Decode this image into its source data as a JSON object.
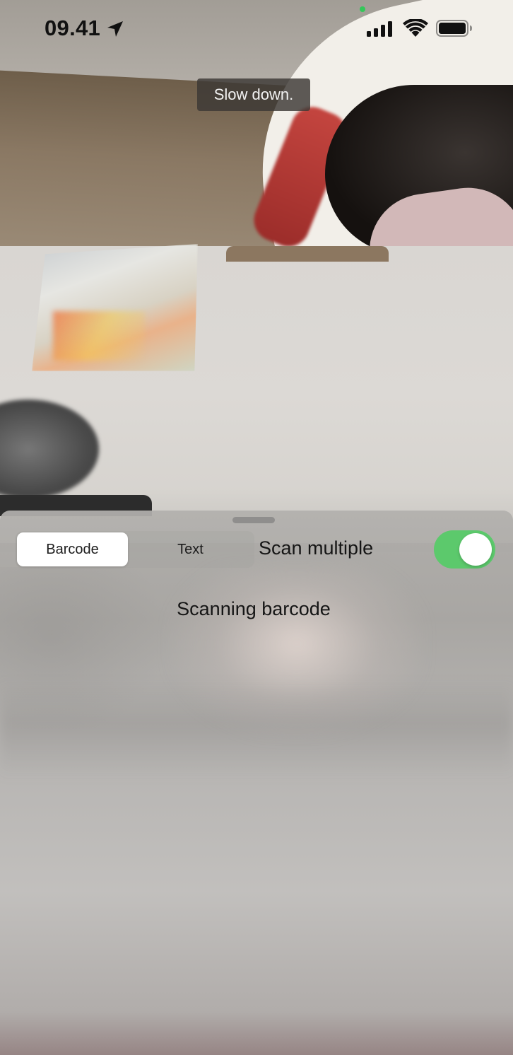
{
  "status_bar": {
    "time": "09.41",
    "icons": [
      "location-arrow-icon",
      "signal-icon",
      "wifi-icon",
      "battery-icon"
    ],
    "camera_indicator_color": "#34c759"
  },
  "toast": {
    "message": "Slow down."
  },
  "sheet": {
    "mode_tabs": [
      {
        "label": "Barcode",
        "selected": true
      },
      {
        "label": "Text",
        "selected": false
      }
    ],
    "scan_multiple": {
      "label": "Scan multiple",
      "enabled": true,
      "toggle_color": "#5cc96c"
    },
    "status_text": "Scanning barcode"
  }
}
